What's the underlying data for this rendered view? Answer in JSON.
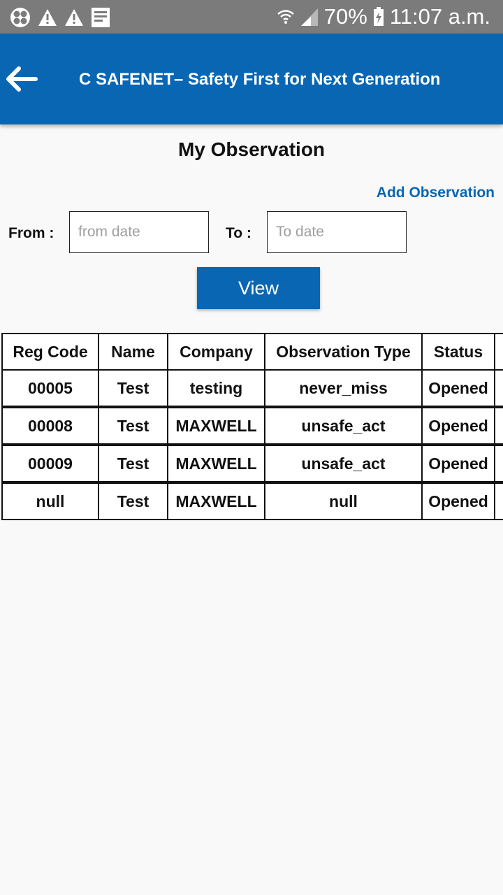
{
  "status_bar": {
    "battery": "70%",
    "time": "11:07 a.m.",
    "icons": [
      "fan-icon",
      "warning-icon",
      "warning-icon",
      "document-icon",
      "wifi-icon",
      "signal-icon",
      "battery-charging-icon"
    ]
  },
  "app_bar": {
    "title": "C SAFENET– Safety First for Next Generation",
    "back_icon": "arrow-left-icon",
    "background": "#0966b2"
  },
  "page": {
    "title": "My Observation",
    "add_link": "Add Observation"
  },
  "filter": {
    "from_label": "From :",
    "from_placeholder": "from date",
    "from_value": "",
    "to_label": "To :",
    "to_placeholder": "To date",
    "to_value": "",
    "view_button": "View"
  },
  "table": {
    "headers": [
      "Reg Code",
      "Name",
      "Company",
      "Observation Type",
      "Status",
      ""
    ],
    "rows": [
      [
        "00005",
        "Test",
        "testing",
        "never_miss",
        "Opened",
        ""
      ],
      [
        "00008",
        "Test",
        "MAXWELL",
        "unsafe_act",
        "Opened",
        ""
      ],
      [
        "00009",
        "Test",
        "MAXWELL",
        "unsafe_act",
        "Opened",
        ""
      ],
      [
        "null",
        "Test",
        "MAXWELL",
        "null",
        "Opened",
        ""
      ]
    ]
  },
  "colors": {
    "accent": "#0966b2",
    "status_bar": "#7b7b7b",
    "background": "#f9f9f9"
  }
}
